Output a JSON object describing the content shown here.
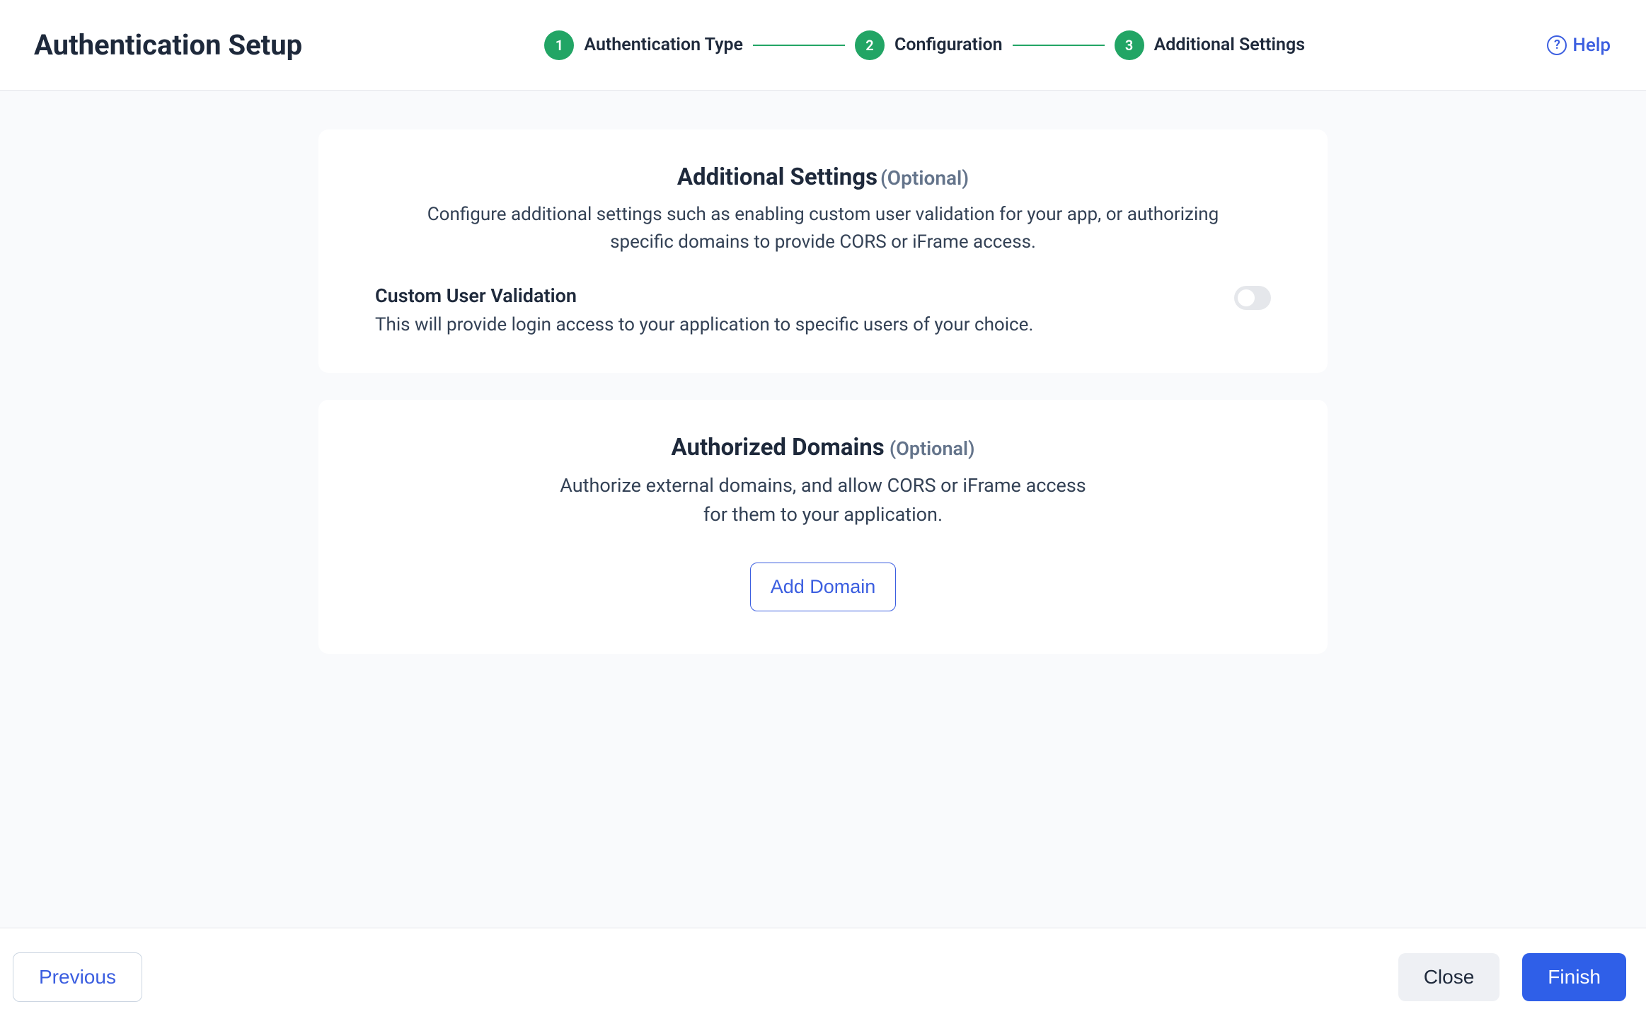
{
  "header": {
    "title": "Authentication Setup",
    "help_label": "Help"
  },
  "stepper": {
    "steps": [
      {
        "num": "1",
        "label": "Authentication Type"
      },
      {
        "num": "2",
        "label": "Configuration"
      },
      {
        "num": "3",
        "label": "Additional Settings"
      }
    ]
  },
  "card1": {
    "title": "Additional Settings",
    "optional": "(Optional)",
    "description": "Configure additional settings such as enabling custom user validation for your app, or authorizing specific domains to provide CORS or iFrame access.",
    "setting": {
      "title": "Custom User Validation",
      "description": "This will provide login access to your application to specific users of your choice."
    }
  },
  "card2": {
    "title": "Authorized Domains",
    "optional": "(Optional)",
    "description": "Authorize external domains, and allow CORS or iFrame access for them to your application.",
    "button": "Add Domain"
  },
  "footer": {
    "previous": "Previous",
    "close": "Close",
    "finish": "Finish"
  }
}
